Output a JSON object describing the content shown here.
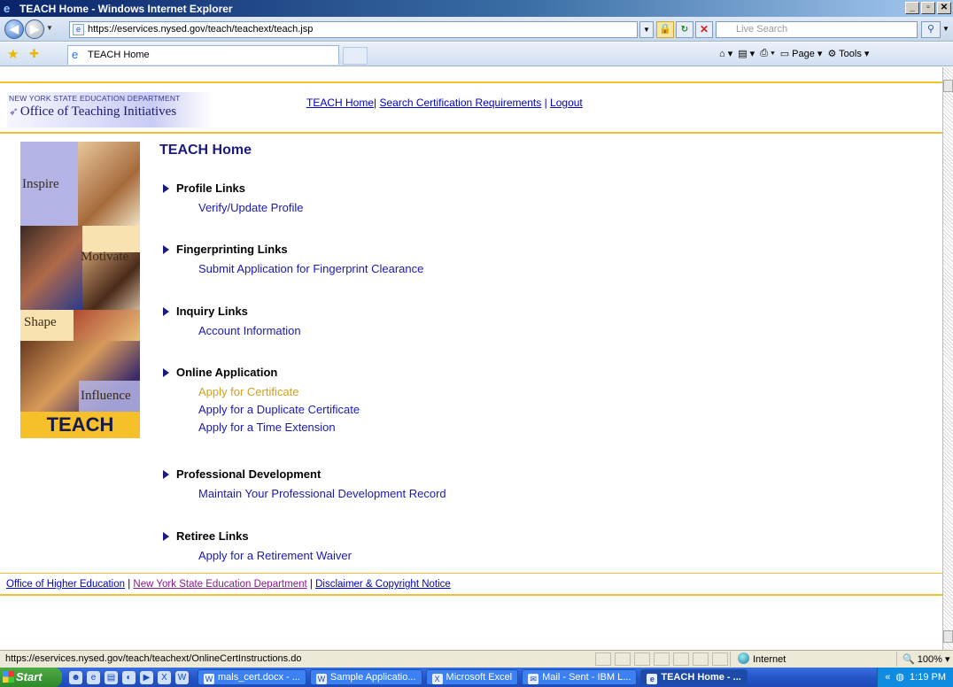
{
  "window": {
    "title": "TEACH Home - Windows Internet Explorer"
  },
  "address": {
    "url": "https://eservices.nysed.gov/teach/teachext/teach.jsp"
  },
  "search": {
    "placeholder": "Live Search"
  },
  "tab": {
    "label": "TEACH Home"
  },
  "toolbar": {
    "page": "Page",
    "tools": "Tools"
  },
  "header": {
    "dept": "NEW YORK STATE EDUCATION DEPARTMENT",
    "office": "Office of Teaching Initiatives",
    "links": [
      "TEACH Home",
      "Search Certification Requirements",
      "Logout"
    ]
  },
  "collage": {
    "inspire": "Inspire",
    "motivate": "Motivate",
    "shape": "Shape",
    "influence": "Influence",
    "teach": "TEACH"
  },
  "main": {
    "title": "TEACH Home",
    "sections": [
      {
        "heading": "Profile Links",
        "links": [
          "Verify/Update Profile"
        ]
      },
      {
        "heading": "Fingerprinting Links",
        "links": [
          "Submit Application for Fingerprint Clearance"
        ]
      },
      {
        "heading": "Inquiry Links",
        "links": [
          "Account Information"
        ]
      },
      {
        "heading": "Online Application",
        "links": [
          "Apply for Certificate",
          "Apply for a Duplicate Certificate",
          "Apply for a Time Extension"
        ]
      },
      {
        "heading": "Professional Development",
        "links": [
          "Maintain Your Professional Development Record"
        ]
      },
      {
        "heading": "Retiree Links",
        "links": [
          "Apply for a Retirement Waiver"
        ]
      }
    ]
  },
  "footer": {
    "links": [
      "Office of Higher Education",
      "New York State Education Department",
      "Disclaimer & Copyright Notice"
    ]
  },
  "status": {
    "url": "https://eservices.nysed.gov/teach/teachext/OnlineCertInstructions.do",
    "zone": "Internet",
    "zoom": "100%"
  },
  "taskbar": {
    "start": "Start",
    "buttons": [
      "mals_cert.docx - ...",
      "Sample Applicatio...",
      "Microsoft Excel",
      "Mail - Sent - IBM L...",
      "TEACH Home - ..."
    ],
    "clock": "1:19 PM"
  }
}
